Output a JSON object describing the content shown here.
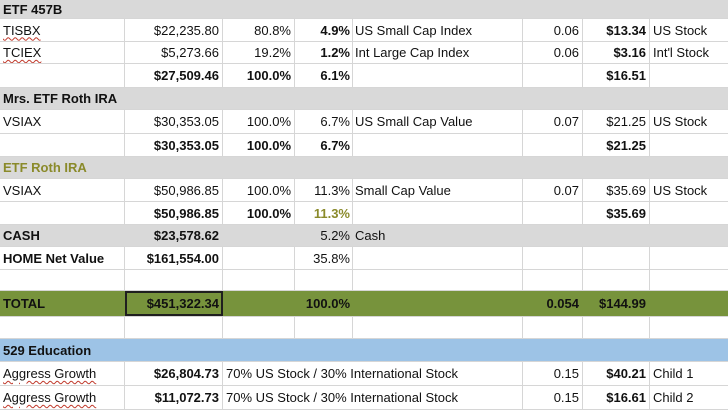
{
  "sections": {
    "etf457b": "ETF 457B",
    "mrs_roth": "Mrs. ETF Roth IRA",
    "etf_roth": "ETF Roth IRA",
    "education": "529 Education"
  },
  "rows": {
    "tisbx": [
      "TISBX",
      "$22,235.80",
      "80.8%",
      "4.9%",
      "US Small Cap Index",
      "0.06",
      "$13.34",
      "US Stock"
    ],
    "tciex": [
      "TCIEX",
      "$5,273.66",
      "19.2%",
      "1.2%",
      "Int Large Cap  Index",
      "0.06",
      "$3.16",
      "Int'l Stock"
    ],
    "sub457": [
      "",
      "$27,509.46",
      "100.0%",
      "6.1%",
      "",
      "",
      "$16.51",
      ""
    ],
    "vsiax1": [
      "VSIAX",
      "$30,353.05",
      "100.0%",
      "6.7%",
      "US Small Cap Value",
      "0.07",
      "$21.25",
      "US Stock"
    ],
    "subMrs": [
      "",
      "$30,353.05",
      "100.0%",
      "6.7%",
      "",
      "",
      "$21.25",
      ""
    ],
    "vsiax2": [
      "VSIAX",
      "$50,986.85",
      "100.0%",
      "11.3%",
      "Small Cap Value",
      "0.07",
      "$35.69",
      "US Stock"
    ],
    "subRoth": [
      "",
      "$50,986.85",
      "100.0%",
      "11.3%",
      "",
      "",
      "$35.69",
      ""
    ],
    "cash": [
      "CASH",
      "$23,578.62",
      "",
      "5.2%",
      "Cash",
      "",
      "",
      ""
    ],
    "home": [
      "HOME Net Value",
      "$161,554.00",
      "",
      "35.8%",
      "",
      "",
      "",
      ""
    ],
    "total": [
      "TOTAL",
      "$451,322.34",
      "",
      "100.0%",
      "",
      "0.054",
      "$144.99",
      ""
    ],
    "agg1": [
      "Aggress Growth",
      "$26,804.73",
      "70% US Stock / 30% International Stock",
      "",
      "",
      "0.15",
      "$40.21",
      "Child 1"
    ],
    "agg2": [
      "Aggress Growth",
      "$11,072.73",
      "70% US Stock / 30% International Stock",
      "",
      "",
      "0.15",
      "$16.61",
      "Child 2"
    ]
  },
  "colors": {
    "header_gray": "#d9d9d9",
    "total_green": "#77933c",
    "edu_blue": "#9dc3e6"
  }
}
